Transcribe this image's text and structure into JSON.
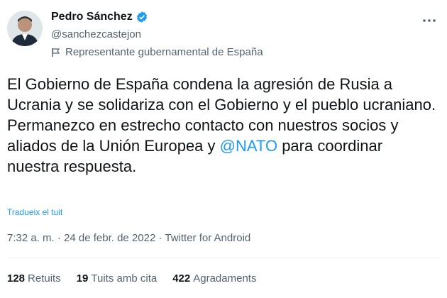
{
  "author": {
    "name": "Pedro Sánchez",
    "handle": "@sanchezcastejon",
    "label": "Representante gubernamental de España"
  },
  "tweet": {
    "text_part1": "El Gobierno de España condena la agresión de Rusia a Ucrania y se solidariza con el Gobierno y el pueblo ucraniano.\nPermanezco en estrecho contacto con nuestros socios y aliados de la Unión Europea y ",
    "mention": "@NATO",
    "text_part2": " para coordinar nuestra respuesta.",
    "translate_label": "Tradueix el tuit",
    "meta": "7:32 a. m. · 24 de febr. de 2022 · Twitter for Android"
  },
  "stats": {
    "retweets_count": "128",
    "retweets_label": "Retuits",
    "quotes_count": "19",
    "quotes_label": "Tuits amb cita",
    "likes_count": "422",
    "likes_label": "Agradaments"
  },
  "colors": {
    "accent": "#1d9bf0",
    "muted": "#536471",
    "text": "#0f1419"
  }
}
